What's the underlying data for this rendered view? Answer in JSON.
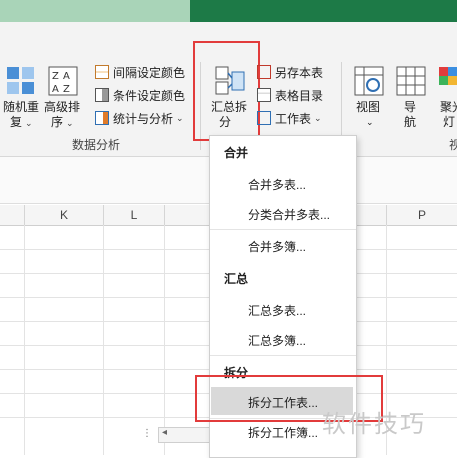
{
  "ribbon": {
    "random_btn": {
      "line1": "随机重",
      "line2": "复"
    },
    "sort_btn": {
      "line1": "高级排",
      "line2": "序"
    },
    "small1": "间隔设定颜色",
    "small2": "条件设定颜色",
    "small3": "统计与分析",
    "group_label": "数据分析",
    "summary_btn": {
      "line1": "汇总拆",
      "line2": "分"
    },
    "save_as": "另存本表",
    "table_dir": "表格目录",
    "worksheet": "工作表",
    "view_btn": "视图",
    "nav_btn": {
      "line1": "导",
      "line2": "航"
    },
    "spotlight_btn": {
      "line1": "聚光",
      "line2": "灯"
    },
    "cut_group": "视"
  },
  "sheet": {
    "columns": [
      "K",
      "L",
      "M",
      "P"
    ]
  },
  "menu": {
    "sections": [
      {
        "header": "合并",
        "items": [
          "合并多表...",
          "分类合并多表...",
          "合并多簿..."
        ]
      },
      {
        "header": "汇总",
        "items": [
          "汇总多表...",
          "汇总多簿..."
        ]
      },
      {
        "header": "拆分",
        "items": [
          "拆分工作表...",
          "拆分工作簿..."
        ]
      }
    ]
  },
  "watermark": "软件技巧",
  "colors": {
    "ribbon_bg": "#f3f3f3",
    "highlight_box": "#e23b3b",
    "top_bar": "#1d7a47"
  }
}
